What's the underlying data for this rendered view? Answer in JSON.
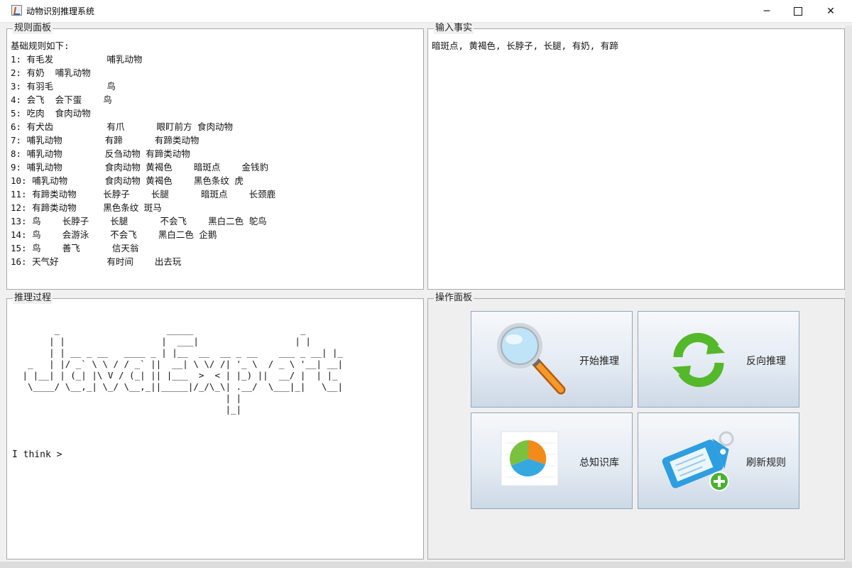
{
  "window": {
    "title": "动物识别推理系统",
    "minimize": "─",
    "close": "✕"
  },
  "rules_panel": {
    "legend": "规则面板",
    "text": "基础规则如下:\n1: 有毛发          哺乳动物\n2: 有奶  哺乳动物\n3: 有羽毛          鸟\n4: 会飞  会下蛋    鸟\n5: 吃肉  食肉动物\n6: 有犬齿          有爪      眼盯前方 食肉动物\n7: 哺乳动物        有蹄      有蹄类动物\n8: 哺乳动物        反刍动物 有蹄类动物\n9: 哺乳动物        食肉动物 黄褐色    暗斑点    金钱豹\n10: 哺乳动物       食肉动物 黄褐色    黑色条纹 虎\n11: 有蹄类动物     长脖子    长腿      暗斑点    长颈鹿\n12: 有蹄类动物     黑色条纹 斑马\n13: 鸟    长脖子    长腿      不会飞    黑白二色 鸵鸟\n14: 鸟    会游泳    不会飞    黑白二色 企鹅\n15: 鸟    善飞      信天翁\n16: 天气好         有时间    出去玩"
  },
  "facts_panel": {
    "legend": "输入事实",
    "text": "暗斑点, 黄褐色, 长脖子, 长腿, 有奶, 有蹄"
  },
  "inference_panel": {
    "legend": "推理过程",
    "banner": "       _                    _____                    _\n      | |                  |  ___|                  | |\n      | | __ _ __   ____ _ | |__  __  __ _ __    ___ _ __| |_\n  _   | |/ _` \\ \\ / / _` ||  __| \\ \\/ /| '_ \\  / _ \\ '__| __|\n | |__| | (_| |\\ V / (_| || |___  >  < | |_) ||  __/ |  | |_\n  \\____/ \\__,_| \\_/ \\__,_||_____|/_/\\_\\| .__/  \\___|_|   \\__|\n                                       | |\n                                       |_|",
    "prompt": "I think >"
  },
  "operation_panel": {
    "legend": "操作面板",
    "buttons": [
      {
        "label": "开始推理",
        "icon": "magnifier-icon"
      },
      {
        "label": "反向推理",
        "icon": "refresh-icon"
      },
      {
        "label": "总知识库",
        "icon": "pie-chart-icon"
      },
      {
        "label": "刷新规则",
        "icon": "tag-add-icon"
      }
    ]
  }
}
